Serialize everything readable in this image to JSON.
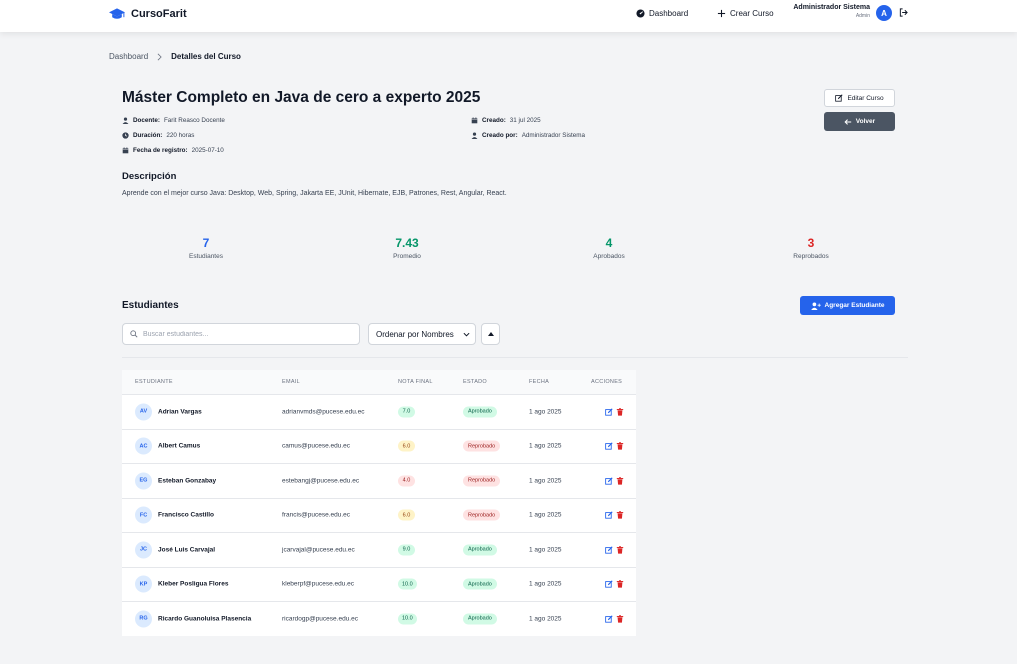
{
  "navbar": {
    "brand": "CursoFarit",
    "brand_icon": "graduation-cap-icon",
    "links": [
      {
        "label": "Dashboard",
        "icon": "gauge-icon"
      },
      {
        "label": "Crear Curso",
        "icon": "plus-icon"
      }
    ],
    "user_name": "Administrador Sistema",
    "user_role": "Admin",
    "avatar_initial": "A",
    "logout_icon": "sign-out-icon",
    "accent": "#2563eb"
  },
  "breadcrumb": {
    "home": "Dashboard",
    "current": "Detalles del Curso"
  },
  "course": {
    "title": "Máster Completo en Java de cero a experto 2025",
    "teacher_label": "Docente:",
    "teacher": "Farit Reasco Docente",
    "duration_label": "Duración:",
    "duration": "220 horas",
    "registered_label": "Fecha de registro:",
    "registered": "2025-07-10",
    "created_label": "Creado:",
    "created": "31 jul 2025",
    "created_by_label": "Creado por:",
    "created_by": "Administrador Sistema",
    "edit_button": "Editar Curso",
    "back_button": "Volver",
    "description_title": "Descripción",
    "description": "Aprende con el mejor curso Java: Desktop, Web, Spring, Jakarta EE, JUnit, Hibernate, EJB, Patrones, Rest, Angular, React."
  },
  "stats": [
    {
      "value": "7",
      "label": "Estudiantes",
      "color": "#2563eb"
    },
    {
      "value": "7.43",
      "label": "Promedio",
      "color": "#059669"
    },
    {
      "value": "4",
      "label": "Aprobados",
      "color": "#059669"
    },
    {
      "value": "3",
      "label": "Reprobados",
      "color": "#dc2626"
    }
  ],
  "students": {
    "title": "Estudiantes",
    "add_button": "Agregar Estudiante",
    "search_placeholder": "Buscar estudiantes...",
    "sort_label": "Ordenar por Nombres",
    "columns": [
      "ESTUDIANTE",
      "EMAIL",
      "NOTA FINAL",
      "ESTADO",
      "FECHA",
      "ACCIONES"
    ],
    "rows": [
      {
        "initials": "AV",
        "name": "Adrian Vargas",
        "email": "adrianvmds@pucese.edu.ec",
        "grade": "7.0",
        "status": "Aprobado",
        "date": "1 ago 2025"
      },
      {
        "initials": "AC",
        "name": "Albert Camus",
        "email": "camus@pucese.edu.ec",
        "grade": "6.0",
        "status": "Reprobado",
        "date": "1 ago 2025"
      },
      {
        "initials": "EG",
        "name": "Esteban Gonzabay",
        "email": "estebangj@pucese.edu.ec",
        "grade": "4.0",
        "status": "Reprobado",
        "date": "1 ago 2025"
      },
      {
        "initials": "FC",
        "name": "Francisco Castillo",
        "email": "francis@pucese.edu.ec",
        "grade": "6.0",
        "status": "Reprobado",
        "date": "1 ago 2025"
      },
      {
        "initials": "JC",
        "name": "José Luis Carvajal",
        "email": "jcarvajal@pucese.edu.ec",
        "grade": "9.0",
        "status": "Aprobado",
        "date": "1 ago 2025"
      },
      {
        "initials": "KP",
        "name": "Kleber Posligua Flores",
        "email": "kleberpf@pucese.edu.ec",
        "grade": "10.0",
        "status": "Aprobado",
        "date": "1 ago 2025"
      },
      {
        "initials": "RG",
        "name": "Ricardo Guanoluisa Plasencia",
        "email": "ricardogp@pucese.edu.ec",
        "grade": "10.0",
        "status": "Aprobado",
        "date": "1 ago 2025"
      }
    ]
  }
}
